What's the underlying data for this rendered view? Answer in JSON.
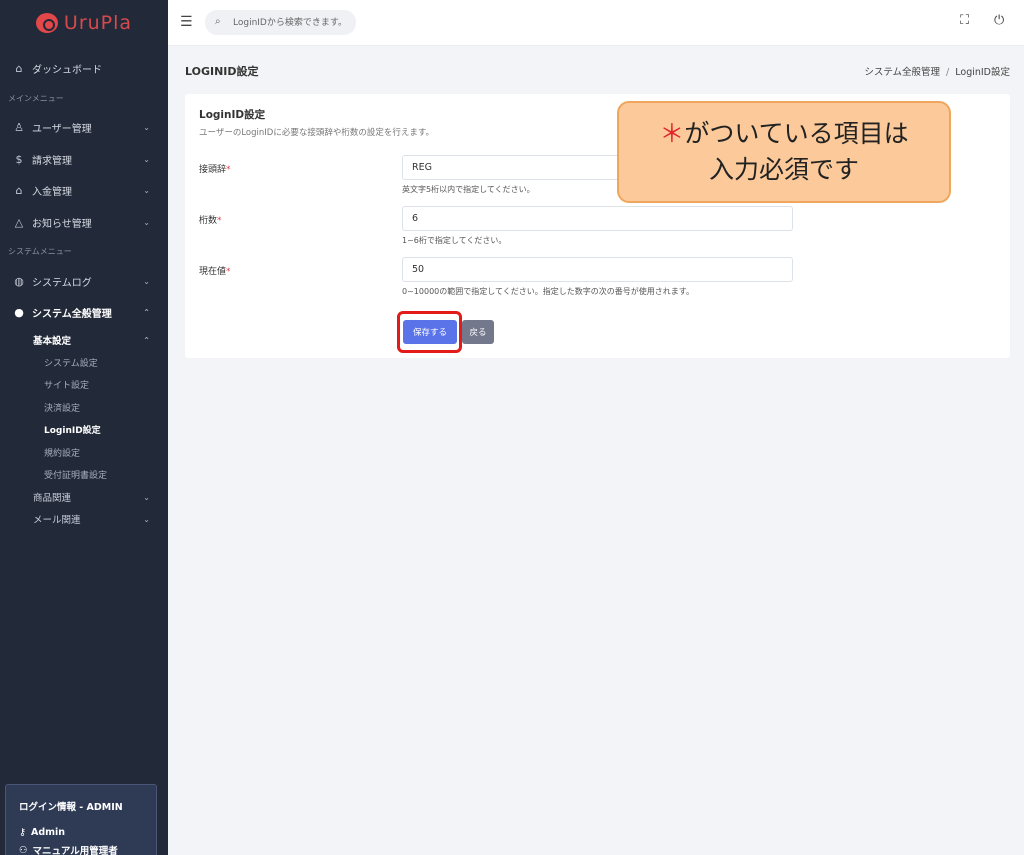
{
  "app": {
    "logo_text": "UruPla"
  },
  "sidebar": {
    "dashboard": "ダッシュボード",
    "main_menu_label": "メインメニュー",
    "main_items": [
      "ユーザー管理",
      "請求管理",
      "入金管理",
      "お知らせ管理"
    ],
    "system_menu_label": "システムメニュー",
    "system_log": "システムログ",
    "system_general": "システム全般管理",
    "basic_settings": "基本設定",
    "basic_sub": [
      "システム設定",
      "サイト設定",
      "決済設定",
      "LoginID設定",
      "規約設定",
      "受付証明書設定"
    ],
    "products": "商品関連",
    "mail": "メール関連"
  },
  "login_info": {
    "title": "ログイン情報 - ADMIN",
    "user": "Admin",
    "role": "マニュアル用管理者"
  },
  "topbar": {
    "search_placeholder": "LoginIDから検索できます。"
  },
  "page": {
    "title": "LOGINID設定",
    "breadcrumb": [
      "システム全般管理",
      "LoginID設定"
    ]
  },
  "card": {
    "title": "LoginID設定",
    "description": "ユーザーのLoginIDに必要な接頭辞や桁数の設定を行えます。",
    "fields": [
      {
        "label": "接頭辞",
        "value": "REG",
        "help": "英文字5桁以内で指定してください。"
      },
      {
        "label": "桁数",
        "value": "6",
        "help": "1~6桁で指定してください。"
      },
      {
        "label": "現在値",
        "value": "50",
        "help": "0~10000の範囲で指定してください。指定した数字の次の番号が使用されます。"
      }
    ],
    "required_mark": "*",
    "save_label": "保存する",
    "back_label": "戻る"
  },
  "callout": {
    "star": "＊",
    "line1": "がついている項目は",
    "line2": "入力必須です"
  },
  "colors": {
    "primary": "#5b73e8",
    "sidebar": "#222938",
    "required": "#e0444a",
    "callout": "#fbc99a"
  }
}
